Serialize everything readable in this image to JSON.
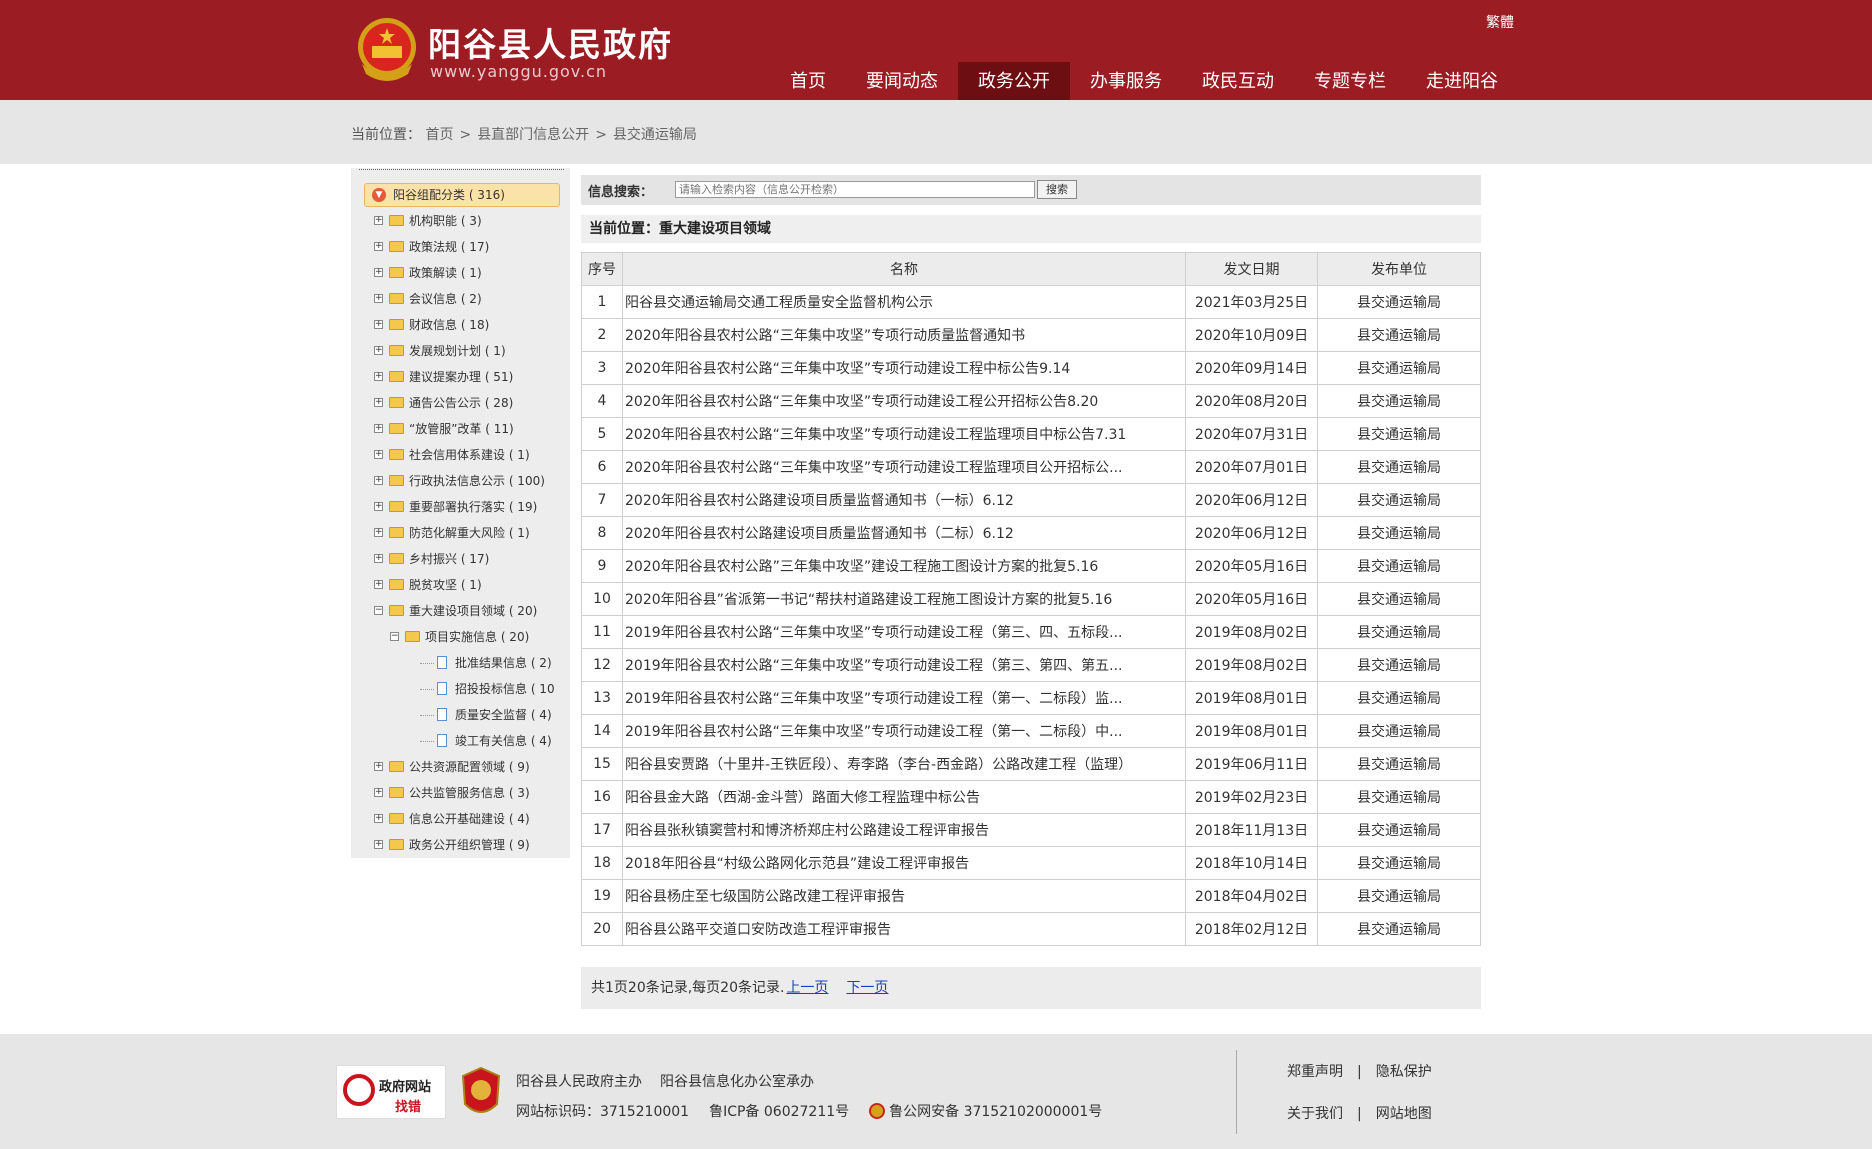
{
  "header": {
    "site_title": "阳谷县人民政府",
    "site_url": "www.yanggu.gov.cn",
    "lang_link": "繁體",
    "nav": [
      "首页",
      "要闻动态",
      "政务公开",
      "办事服务",
      "政民互动",
      "专题专栏",
      "走进阳谷"
    ],
    "active_nav": "政务公开"
  },
  "breadcrumb": {
    "prefix": "当前位置：",
    "items": [
      "首页",
      "县直部门信息公开",
      "县交通运输局"
    ]
  },
  "sidebar": {
    "root": "阳谷组配分类 ( 316)",
    "items": [
      {
        "label": "机构职能 ( 3)"
      },
      {
        "label": "政策法规 ( 17)"
      },
      {
        "label": "政策解读 ( 1)"
      },
      {
        "label": "会议信息 ( 2)"
      },
      {
        "label": "财政信息 ( 18)"
      },
      {
        "label": "发展规划计划 ( 1)"
      },
      {
        "label": "建议提案办理 ( 51)"
      },
      {
        "label": "通告公告公示 ( 28)"
      },
      {
        "label": "“放管服”改革 ( 11)"
      },
      {
        "label": "社会信用体系建设 ( 1)"
      },
      {
        "label": "行政执法信息公示 ( 100)"
      },
      {
        "label": "重要部署执行落实 ( 19)"
      },
      {
        "label": "防范化解重大风险 ( 1)"
      },
      {
        "label": "乡村振兴 ( 17)"
      },
      {
        "label": "脱贫攻坚 ( 1)"
      },
      {
        "label": "重大建设项目领域 ( 20)"
      },
      {
        "label": "项目实施信息 ( 20)"
      },
      {
        "label": "批准结果信息 ( 2)"
      },
      {
        "label": "招投投标信息 ( 10"
      },
      {
        "label": "质量安全监督 ( 4)"
      },
      {
        "label": "竣工有关信息 ( 4)"
      },
      {
        "label": "公共资源配置领域 ( 9)"
      },
      {
        "label": "公共监管服务信息 ( 3)"
      },
      {
        "label": "信息公开基础建设 ( 4)"
      },
      {
        "label": "政务公开组织管理 ( 9)"
      }
    ]
  },
  "search": {
    "label": "信息搜索：",
    "placeholder": "请输入检索内容（信息公开检索）",
    "button": "搜索"
  },
  "current_section": "当前位置：重大建设项目领域",
  "table": {
    "headers": [
      "序号",
      "名称",
      "发文日期",
      "发布单位"
    ],
    "rows": [
      [
        "1",
        "阳谷县交通运输局交通工程质量安全监督机构公示",
        "2021年03月25日",
        "县交通运输局"
      ],
      [
        "2",
        "2020年阳谷县农村公路“三年集中攻坚”专项行动质量监督通知书",
        "2020年10月09日",
        "县交通运输局"
      ],
      [
        "3",
        "2020年阳谷县农村公路“三年集中攻坚”专项行动建设工程中标公告9.14",
        "2020年09月14日",
        "县交通运输局"
      ],
      [
        "4",
        "2020年阳谷县农村公路“三年集中攻坚”专项行动建设工程公开招标公告8.20",
        "2020年08月20日",
        "县交通运输局"
      ],
      [
        "5",
        "2020年阳谷县农村公路“三年集中攻坚”专项行动建设工程监理项目中标公告7.31",
        "2020年07月31日",
        "县交通运输局"
      ],
      [
        "6",
        "2020年阳谷县农村公路“三年集中攻坚”专项行动建设工程监理项目公开招标公...",
        "2020年07月01日",
        "县交通运输局"
      ],
      [
        "7",
        "2020年阳谷县农村公路建设项目质量监督通知书（一标）6.12",
        "2020年06月12日",
        "县交通运输局"
      ],
      [
        "8",
        "2020年阳谷县农村公路建设项目质量监督通知书（二标）6.12",
        "2020年06月12日",
        "县交通运输局"
      ],
      [
        "9",
        "2020年阳谷县农村公路”三年集中攻坚”建设工程施工图设计方案的批复5.16",
        "2020年05月16日",
        "县交通运输局"
      ],
      [
        "10",
        "2020年阳谷县”省派第一书记“帮扶村道路建设工程施工图设计方案的批复5.16",
        "2020年05月16日",
        "县交通运输局"
      ],
      [
        "11",
        "2019年阳谷县农村公路“三年集中攻坚”专项行动建设工程（第三、四、五标段...",
        "2019年08月02日",
        "县交通运输局"
      ],
      [
        "12",
        "2019年阳谷县农村公路“三年集中攻坚”专项行动建设工程（第三、第四、第五...",
        "2019年08月02日",
        "县交通运输局"
      ],
      [
        "13",
        "2019年阳谷县农村公路“三年集中攻坚”专项行动建设工程（第一、二标段）监...",
        "2019年08月01日",
        "县交通运输局"
      ],
      [
        "14",
        "2019年阳谷县农村公路“三年集中攻坚”专项行动建设工程（第一、二标段）中...",
        "2019年08月01日",
        "县交通运输局"
      ],
      [
        "15",
        "阳谷县安贾路（十里井-王铁匠段）、寿李路（李台-西金路）公路改建工程（监理）",
        "2019年06月11日",
        "县交通运输局"
      ],
      [
        "16",
        "阳谷县金大路（西湖-金斗营）路面大修工程监理中标公告",
        "2019年02月23日",
        "县交通运输局"
      ],
      [
        "17",
        "阳谷县张秋镇窦营村和博济桥郑庄村公路建设工程评审报告",
        "2018年11月13日",
        "县交通运输局"
      ],
      [
        "18",
        "2018年阳谷县“村级公路网化示范县”建设工程评审报告",
        "2018年10月14日",
        "县交通运输局"
      ],
      [
        "19",
        "阳谷县杨庄至七级国防公路改建工程评审报告",
        "2018年04月02日",
        "县交通运输局"
      ],
      [
        "20",
        "阳谷县公路平交道口安防改造工程评审报告",
        "2018年02月12日",
        "县交通运输局"
      ]
    ]
  },
  "pager": {
    "summary": "共1页20条记录,每页20条记录.",
    "prev": "上一页",
    "next": "下一页"
  },
  "footer": {
    "badge_line1": "政府网站",
    "badge_line2": "找错",
    "sponsor": "阳谷县人民政府主办",
    "organizer": "阳谷县信息化办公室承办",
    "site_id": "网站标识码：3715210001",
    "icp": "鲁ICP备 06027211号",
    "police": "鲁公网安备 37152102000001号",
    "links_row1": [
      "郑重声明",
      "隐私保护"
    ],
    "links_row2": [
      "关于我们",
      "网站地图"
    ]
  },
  "colors": {
    "brand_red": "#9b1c22",
    "active_nav": "#6d0e13",
    "link_blue": "#1a3fbf"
  }
}
